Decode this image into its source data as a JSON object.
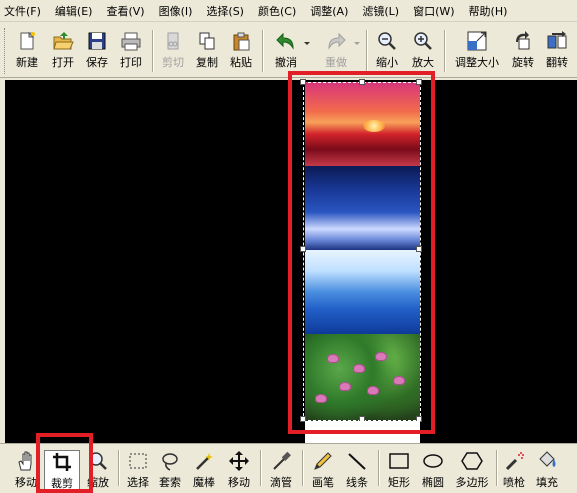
{
  "menubar": {
    "items": [
      "文件(F)",
      "编辑(E)",
      "查看(V)",
      "图像(I)",
      "选择(S)",
      "颜色(C)",
      "调整(A)",
      "滤镜(L)",
      "窗口(W)",
      "帮助(H)"
    ]
  },
  "toolbar": {
    "new": "新建",
    "open": "打开",
    "save": "保存",
    "print": "打印",
    "cut": "剪切",
    "copy": "复制",
    "paste": "粘贴",
    "undo": "撤消",
    "redo": "重做",
    "zoom_out": "缩小",
    "zoom_in": "放大",
    "resize": "调整大小",
    "rotate": "旋转",
    "flip": "翻转"
  },
  "tools": {
    "move_pan": "移动",
    "crop": "裁剪",
    "zoom": "缩放",
    "select": "选择",
    "lasso": "套索",
    "magic_wand": "魔棒",
    "move": "移动",
    "eyedropper": "滴管",
    "brush": "画笔",
    "line": "线条",
    "rectangle": "矩形",
    "ellipse": "椭圆",
    "polygon": "多边形",
    "spray": "喷枪",
    "fill": "填充"
  },
  "colors": {
    "highlight": "#e21f26",
    "canvas_bg": "#000000",
    "chrome_bg": "#ece9d8"
  }
}
